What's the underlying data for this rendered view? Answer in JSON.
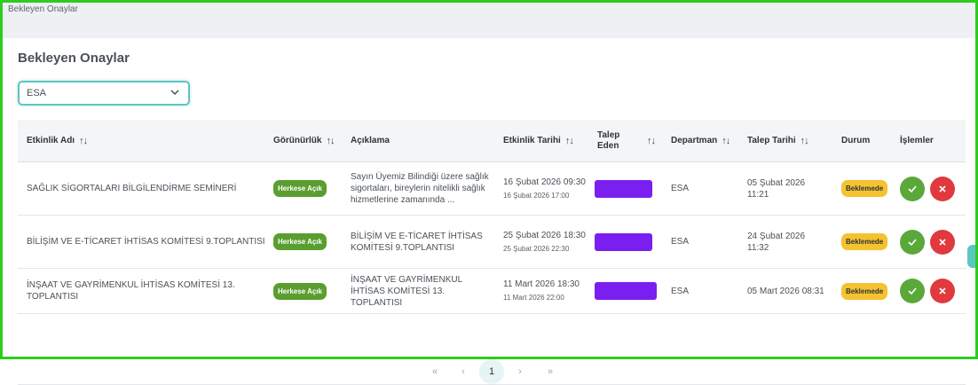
{
  "window": {
    "title": "Bekleyen Onaylar"
  },
  "page": {
    "title": "Bekleyen Onaylar"
  },
  "filter": {
    "selected": "ESA"
  },
  "table": {
    "columns": {
      "name": "Etkinlik Adı",
      "visibility": "Görünürlük",
      "description": "Açıklama",
      "event_date": "Etkinlik Tarihi",
      "requester_line1": "Talep",
      "requester_line2": "Eden",
      "department": "Departman",
      "request_date": "Talep Tarihi",
      "status": "Durum",
      "actions": "İşlemler"
    },
    "rows": [
      {
        "name": "SAĞLIK SİGORTALARI BİLGİLENDİRME SEMİNERİ",
        "visibility": "Herkese Açık",
        "description": "Sayın Üyemiz Bilindiği üzere sağlık sigortaları, bireylerin nitelikli sağlık hizmetlerine zamanında ...",
        "event_start": "16 Şubat 2026 09:30",
        "event_end": "16 Şubat 2026 17:00",
        "department": "ESA",
        "request_date": "05 Şubat 2026 11:21",
        "status": "Beklemede"
      },
      {
        "name": "BİLİŞİM VE E-TİCARET İHTİSAS KOMİTESİ 9.TOPLANTISI",
        "visibility": "Herkese Açık",
        "description": "BİLİŞİM VE E-TİCARET İHTİSAS KOMİTESİ 9.TOPLANTISI",
        "event_start": "25 Şubat 2026 18:30",
        "event_end": "25 Şubat 2026 22:30",
        "department": "ESA",
        "request_date": "24 Şubat 2026 11:32",
        "status": "Beklemede"
      },
      {
        "name": "İNŞAAT VE GAYRİMENKUL İHTİSAS KOMİTESİ 13. TOPLANTISI",
        "visibility": "Herkese Açık",
        "description": "İNŞAAT VE GAYRİMENKUL İHTİSAS KOMİTESİ 13. TOPLANTISI",
        "event_start": "11 Mart 2026 18:30",
        "event_end": "11 Mart 2026 22:00",
        "department": "ESA",
        "request_date": "05 Mart 2026 08:31",
        "status": "Beklemede"
      }
    ]
  },
  "pagination": {
    "first": "«",
    "prev": "‹",
    "current": "1",
    "next": "›",
    "last": "»"
  },
  "icons": {
    "sort": "sort-arrows-icon",
    "approve": "check-icon",
    "reject": "close-icon",
    "dropdown": "chevron-down-icon"
  },
  "colors": {
    "accent": "#5cc6c3",
    "visibility_badge": "#5a9e2f",
    "status_badge": "#f5c230",
    "approve": "#5aa83a",
    "reject": "#e0393e",
    "redaction": "#7a1ff0"
  }
}
